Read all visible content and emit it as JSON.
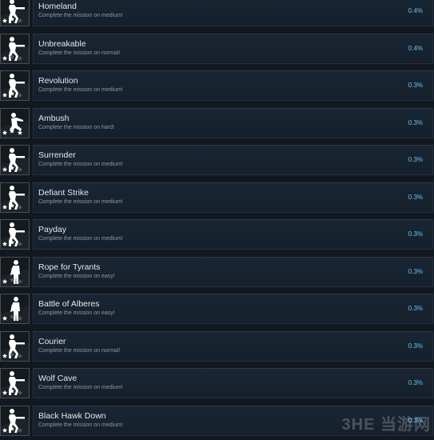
{
  "achievements": [
    {
      "title": "Homeland",
      "description": "Complete the mission on medium!",
      "percent": "0.4%",
      "stars": 2,
      "pose": "aim"
    },
    {
      "title": "Unbreakable",
      "description": "Complete the mission on normal!",
      "percent": "0.4%",
      "stars": 1,
      "pose": "aim"
    },
    {
      "title": "Revolution",
      "description": "Complete the mission on medium!",
      "percent": "0.3%",
      "stars": 2,
      "pose": "aim"
    },
    {
      "title": "Ambush",
      "description": "Complete the mission on hard!",
      "percent": "0.3%",
      "stars": 3,
      "pose": "crouch"
    },
    {
      "title": "Surrender",
      "description": "Complete the mission on medium!",
      "percent": "0.3%",
      "stars": 2,
      "pose": "aim"
    },
    {
      "title": "Defiant Strike",
      "description": "Complete the mission on medium!",
      "percent": "0.3%",
      "stars": 2,
      "pose": "aim"
    },
    {
      "title": "Payday",
      "description": "Complete the mission on medium!",
      "percent": "0.3%",
      "stars": 2,
      "pose": "aim"
    },
    {
      "title": "Rope for Tyrants",
      "description": "Complete the mission on easy!",
      "percent": "0.3%",
      "stars": 1,
      "pose": "stand"
    },
    {
      "title": "Battle of Alberes",
      "description": "Complete the mission on easy!",
      "percent": "0.3%",
      "stars": 1,
      "pose": "stand"
    },
    {
      "title": "Courier",
      "description": "Complete the mission on normal!",
      "percent": "0.3%",
      "stars": 1,
      "pose": "aim"
    },
    {
      "title": "Wolf Cave",
      "description": "Complete the mission on medium!",
      "percent": "0.3%",
      "stars": 2,
      "pose": "aim"
    },
    {
      "title": "Black Hawk Down",
      "description": "Complete the mission on medium!",
      "percent": "0.3%",
      "stars": 2,
      "pose": "aim"
    }
  ],
  "watermark": "3HE 当游网",
  "colors": {
    "background": "#121820",
    "title": "#e6e8ea",
    "description": "#8f98a0",
    "percent": "#67c1f5",
    "star_on": "#ffffff",
    "star_off": "#555a60"
  }
}
